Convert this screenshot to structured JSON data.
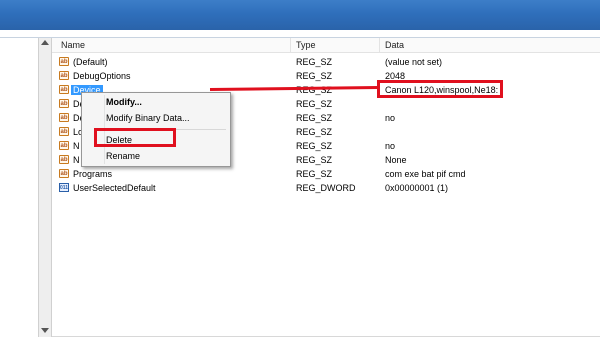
{
  "columns": {
    "name": "Name",
    "type": "Type",
    "data": "Data"
  },
  "rows": [
    {
      "name": "(Default)",
      "type": "REG_SZ",
      "data": "(value not set)",
      "icon": "string-value-icon"
    },
    {
      "name": "DebugOptions",
      "type": "REG_SZ",
      "data": "2048",
      "icon": "string-value-icon"
    },
    {
      "name": "Device",
      "type": "REG_SZ",
      "data": "Canon L120,winspool,Ne18:",
      "icon": "string-value-icon",
      "selected": true
    },
    {
      "name": "De",
      "type": "REG_SZ",
      "data": "",
      "icon": "string-value-icon"
    },
    {
      "name": "De",
      "type": "REG_SZ",
      "data": "no",
      "icon": "string-value-icon"
    },
    {
      "name": "Lo",
      "type": "REG_SZ",
      "data": "",
      "icon": "string-value-icon"
    },
    {
      "name": "N",
      "type": "REG_SZ",
      "data": "no",
      "icon": "string-value-icon"
    },
    {
      "name": "N",
      "type": "REG_SZ",
      "data": "None",
      "icon": "string-value-icon"
    },
    {
      "name": "Programs",
      "type": "REG_SZ",
      "data": "com exe bat pif cmd",
      "icon": "string-value-icon"
    },
    {
      "name": "UserSelectedDefault",
      "type": "REG_DWORD",
      "data": "0x00000001 (1)",
      "icon": "binary-value-icon"
    }
  ],
  "context_menu": {
    "modify": "Modify...",
    "modify_binary": "Modify Binary Data...",
    "delete": "Delete",
    "rename": "Rename"
  },
  "icon_glyphs": {
    "string": "ab",
    "binary": "011"
  },
  "colors": {
    "highlight": "#e0101e",
    "selection": "#3399ff",
    "titlebar": "#2f6fbb"
  }
}
